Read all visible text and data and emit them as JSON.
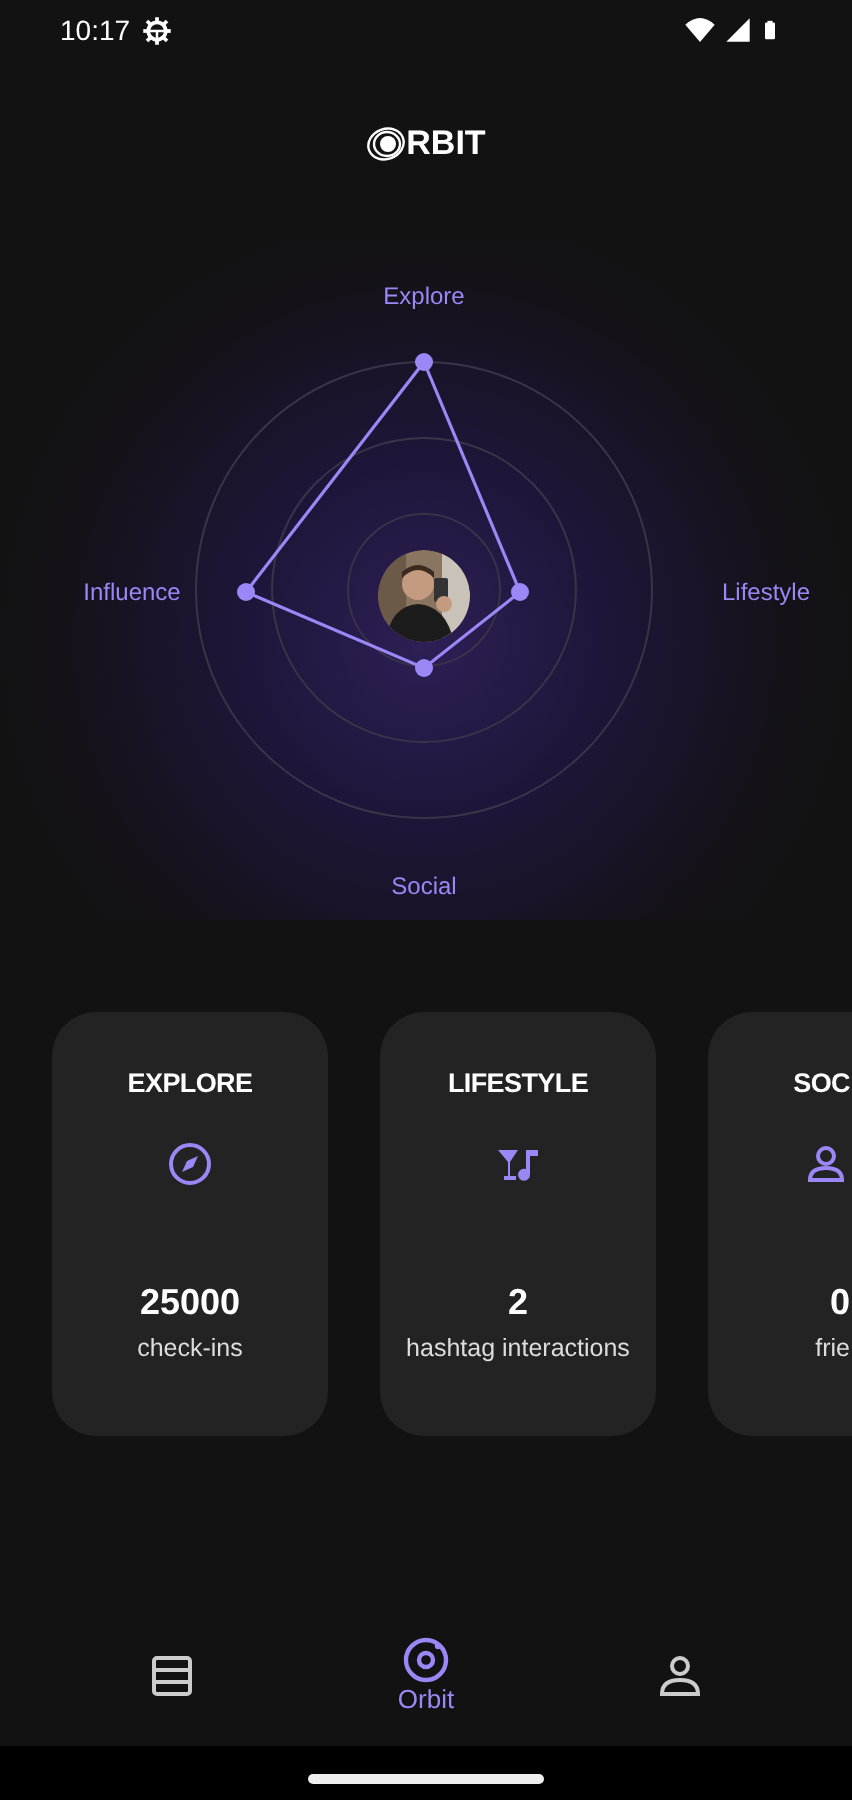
{
  "status_bar": {
    "time": "10:17"
  },
  "logo": {
    "text": "RBIT"
  },
  "radar": {
    "axes": [
      {
        "label": "Explore"
      },
      {
        "label": "Lifestyle"
      },
      {
        "label": "Social"
      },
      {
        "label": "Influence"
      }
    ]
  },
  "cards": [
    {
      "kind": "compass",
      "title": "EXPLORE",
      "value": "25000",
      "caption": "check-ins"
    },
    {
      "kind": "drinks",
      "title": "LIFESTYLE",
      "value": "2",
      "caption": "hashtag interactions"
    },
    {
      "kind": "person",
      "title": "SOC",
      "value": "0",
      "caption": "frie"
    }
  ],
  "bottom_nav": [
    {
      "kind": "list",
      "selected": false
    },
    {
      "kind": "orbit",
      "label": "Orbit",
      "selected": true
    },
    {
      "kind": "person",
      "selected": false
    }
  ]
}
